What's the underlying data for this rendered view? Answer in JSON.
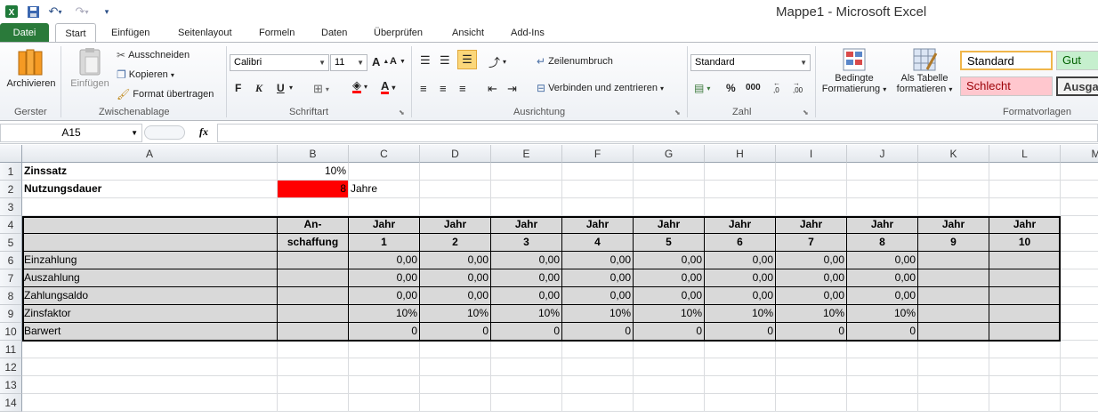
{
  "window": {
    "title": "Mappe1  -  Microsoft Excel",
    "accent": "#2a7a3a"
  },
  "tabs": [
    "Datei",
    "Start",
    "Einfügen",
    "Seitenlayout",
    "Formeln",
    "Daten",
    "Überprüfen",
    "Ansicht",
    "Add-Ins"
  ],
  "ribbon": {
    "gerster": {
      "button": "Archivieren",
      "label": "Gerster"
    },
    "clipboard": {
      "paste": "Einfügen",
      "cut": "Ausschneiden",
      "copy": "Kopieren",
      "format_painter": "Format übertragen",
      "label": "Zwischenablage"
    },
    "font": {
      "name": "Calibri",
      "size": "11",
      "bold": "F",
      "italic": "K",
      "underline": "U",
      "label": "Schriftart"
    },
    "alignment": {
      "wrap": "Zeilenumbruch",
      "merge": "Verbinden und zentrieren",
      "label": "Ausrichtung"
    },
    "number": {
      "format": "Standard",
      "percent": "%",
      "thousands": "000",
      "inc_dec": ",0 ,00",
      "label": "Zahl"
    },
    "styles": {
      "cond_format": [
        "Bedingte",
        "Formatierung"
      ],
      "as_table": [
        "Als Tabelle",
        "formatieren"
      ],
      "items": [
        {
          "name": "Standard",
          "bg": "#ffffff",
          "color": "#000000"
        },
        {
          "name": "Gut",
          "bg": "#c6efce",
          "color": "#006100"
        },
        {
          "name": "Schlecht",
          "bg": "#ffc7ce",
          "color": "#9c0006"
        },
        {
          "name": "Ausgab",
          "bg": "#f2f2f2",
          "color": "#3f3f3f"
        }
      ],
      "label": "Formatvorlagen"
    }
  },
  "formula_bar": {
    "name_box": "A15",
    "fx": "fx",
    "content": ""
  },
  "sheet": {
    "columns": [
      "A",
      "B",
      "C",
      "D",
      "E",
      "F",
      "G",
      "H",
      "I",
      "J",
      "K",
      "L",
      "M"
    ],
    "rows": [
      "1",
      "2",
      "3",
      "4",
      "5",
      "6",
      "7",
      "8",
      "9",
      "10",
      "11",
      "12",
      "13",
      "14"
    ],
    "row1": {
      "label": "Zinssatz",
      "value": "10%"
    },
    "row2": {
      "label": "Nutzungsdauer",
      "value": "8",
      "unit": "Jahre",
      "highlight": "#ff0000"
    },
    "header4": [
      "An-",
      "Jahr",
      "Jahr",
      "Jahr",
      "Jahr",
      "Jahr",
      "Jahr",
      "Jahr",
      "Jahr",
      "Jahr",
      "Jahr"
    ],
    "header5": [
      "schaffung",
      "1",
      "2",
      "3",
      "4",
      "5",
      "6",
      "7",
      "8",
      "9",
      "10"
    ],
    "data_rows": [
      {
        "label": "Einzahlung",
        "values": [
          "0,00",
          "0,00",
          "0,00",
          "0,00",
          "0,00",
          "0,00",
          "0,00",
          "0,00"
        ]
      },
      {
        "label": "Auszahlung",
        "values": [
          "0,00",
          "0,00",
          "0,00",
          "0,00",
          "0,00",
          "0,00",
          "0,00",
          "0,00"
        ]
      },
      {
        "label": "Zahlungsaldo",
        "values": [
          "0,00",
          "0,00",
          "0,00",
          "0,00",
          "0,00",
          "0,00",
          "0,00",
          "0,00"
        ]
      },
      {
        "label": "Zinsfaktor",
        "values": [
          "10%",
          "10%",
          "10%",
          "10%",
          "10%",
          "10%",
          "10%",
          "10%"
        ]
      },
      {
        "label": "Barwert",
        "values": [
          "0",
          "0",
          "0",
          "0",
          "0",
          "0",
          "0",
          "0"
        ]
      }
    ]
  }
}
